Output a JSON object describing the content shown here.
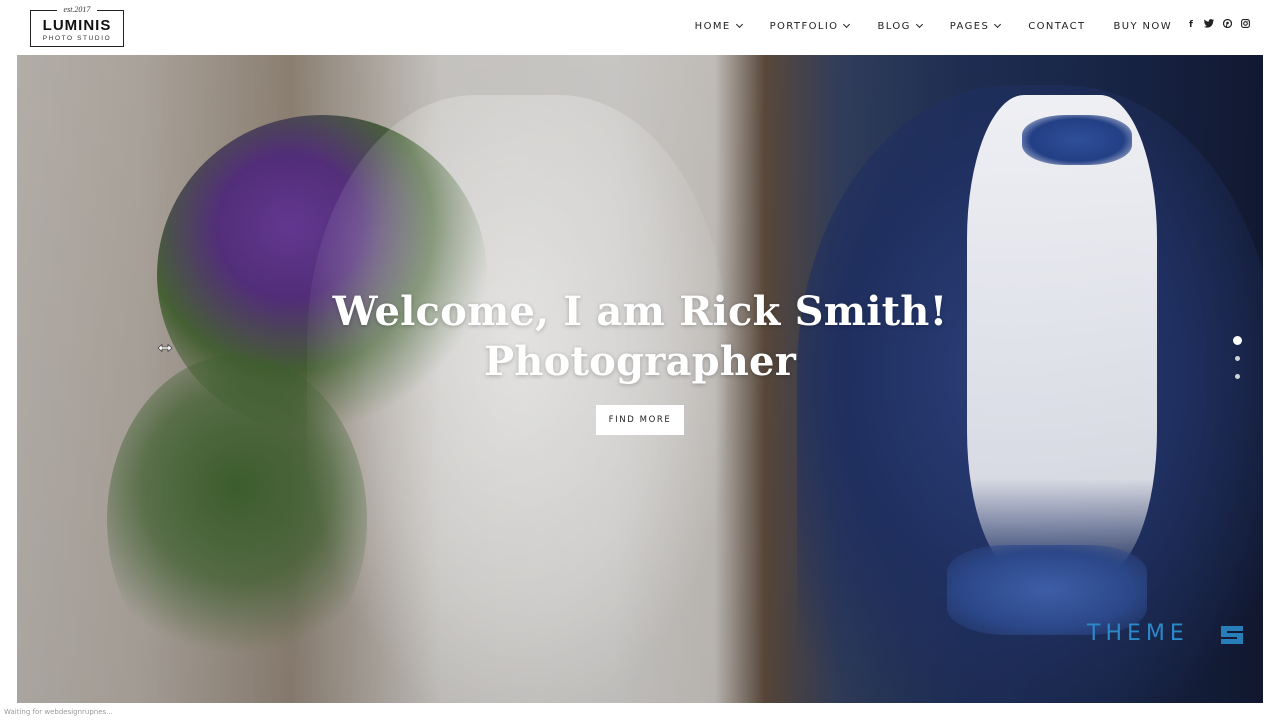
{
  "logo": {
    "est": "est.2017",
    "name": "LUMINIS",
    "subtitle": "PHOTO STUDIO"
  },
  "nav": {
    "items": [
      {
        "label": "HOME",
        "has_dropdown": true
      },
      {
        "label": "PORTFOLIO",
        "has_dropdown": true
      },
      {
        "label": "BLOG",
        "has_dropdown": true
      },
      {
        "label": "PAGES",
        "has_dropdown": true
      },
      {
        "label": "CONTACT",
        "has_dropdown": false
      },
      {
        "label": "BUY NOW",
        "has_dropdown": false
      }
    ]
  },
  "social": {
    "icons": [
      {
        "name": "facebook-icon",
        "glyph": "f"
      },
      {
        "name": "twitter-icon",
        "glyph": "t"
      },
      {
        "name": "pinterest-icon",
        "glyph": "p"
      },
      {
        "name": "instagram-icon",
        "glyph": "◎"
      }
    ]
  },
  "hero": {
    "title_line1": "Welcome, I am Rick Smith!",
    "title_line2": "Photographer",
    "button_label": "FIND MORE",
    "slides": 3,
    "active_slide": 1
  },
  "watermark": {
    "text": "THEME",
    "accent": "#2a89c7"
  },
  "status": {
    "text": "Waiting for webdesignrupnes..."
  },
  "colors": {
    "header_bg": "#ffffff",
    "nav_text": "#222222",
    "hero_text": "#ffffff",
    "button_bg": "#ffffff"
  }
}
